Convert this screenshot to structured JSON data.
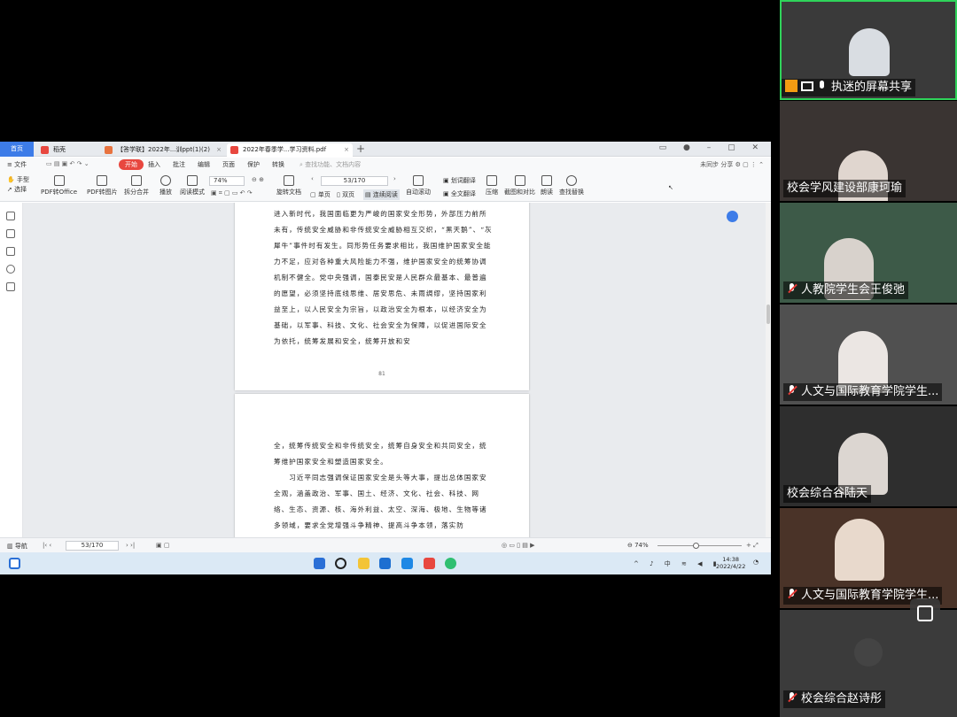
{
  "tabs": {
    "home": "首页",
    "daoke": "稻壳",
    "ppt": "【答学联】2022年...训ppt(1)(2)",
    "pdf": "2022年春季学...学习资料.pdf",
    "add": "+"
  },
  "menus": {
    "file": "≡ 文件",
    "start": "开始",
    "insert": "插入",
    "annotate": "批注",
    "edit": "编辑",
    "page": "页面",
    "protect": "保护",
    "convert": "转换",
    "search_hint": "查找功能、文档内容",
    "right": "未同步  分享"
  },
  "toolbar": {
    "hand": "手型",
    "select": "选择",
    "pdf2office": "PDF转Office",
    "pdf2img": "PDF转图片",
    "split_merge": "拆分合并",
    "play": "播放",
    "read_mode": "阅读模式",
    "zoom": "74%",
    "rotate": "旋转文档",
    "single": "单页",
    "double": "双页",
    "continuous": "连续阅读",
    "page": "53/170",
    "autoscroll": "自动滚动",
    "translate": "划词翻译",
    "fulltranslate": "全文翻译",
    "compress": "压缩",
    "screenshot": "截图和对比",
    "tts": "朗读",
    "replace": "查找替换"
  },
  "doc": {
    "page1_text": "进入新时代，我国面临更为严峻的国家安全形势，外部压力前所未有，传统安全威胁和非传统安全威胁相互交织，“黑天鹅”、“灰犀牛”事件时有发生。同形势任务要求相比，我国维护国家安全能力不足，应对各种重大风险能力不强，维护国家安全的统筹协调机制不健全。党中央强调，国泰民安是人民群众最基本、最普遍的愿望，必须坚持底线思维、居安思危、未雨绸缪，坚持国家利益至上，以人民安全为宗旨，以政治安全为根本，以经济安全为基础，以军事、科技、文化、社会安全为保障，以促进国际安全为依托，统筹发展和安全，统筹开放和安",
    "page1_num": "81",
    "page2_p1": "全，统筹传统安全和非传统安全，统筹自身安全和共同安全，统筹维护国家安全和塑造国家安全。",
    "page2_p2": "　　习近平同志强调保证国家安全是头等大事，提出总体国家安全观，涵盖政治、军事、国土、经济、文化、社会、科技、网络、生态、资源、核、海外利益、太空、深海、极地、生物等诸多领域，要求全党增强斗争精神、提高斗争本领，落实防"
  },
  "status": {
    "nav": "导航",
    "page": "53/170",
    "zoom": "74%"
  },
  "taskbar": {
    "ime": "中",
    "time": "14:38",
    "date": "2022/4/22"
  },
  "participants": [
    {
      "name": "执迷的屏幕共享",
      "mic": "on"
    },
    {
      "name": "校会学风建设部康珂瑜",
      "mic": "none"
    },
    {
      "name": "人教院学生会王俊弛",
      "mic": "off"
    },
    {
      "name": "人文与国际教育学院学生...",
      "mic": "off"
    },
    {
      "name": "校会综合谷陆天",
      "mic": "none"
    },
    {
      "name": "人文与国际教育学院学生...",
      "mic": "off"
    },
    {
      "name": "校会综合赵诗彤",
      "mic": "off"
    }
  ],
  "colors": {
    "accent": "#3d7ce8",
    "start_tab": "#e8473f",
    "active_speaker": "#2fd35a",
    "mic_off": "#e53935"
  },
  "icons": [
    "search-icon",
    "mic-icon",
    "mic-off-icon",
    "screen-share-icon",
    "edit-icon",
    "camera-off-icon"
  ]
}
